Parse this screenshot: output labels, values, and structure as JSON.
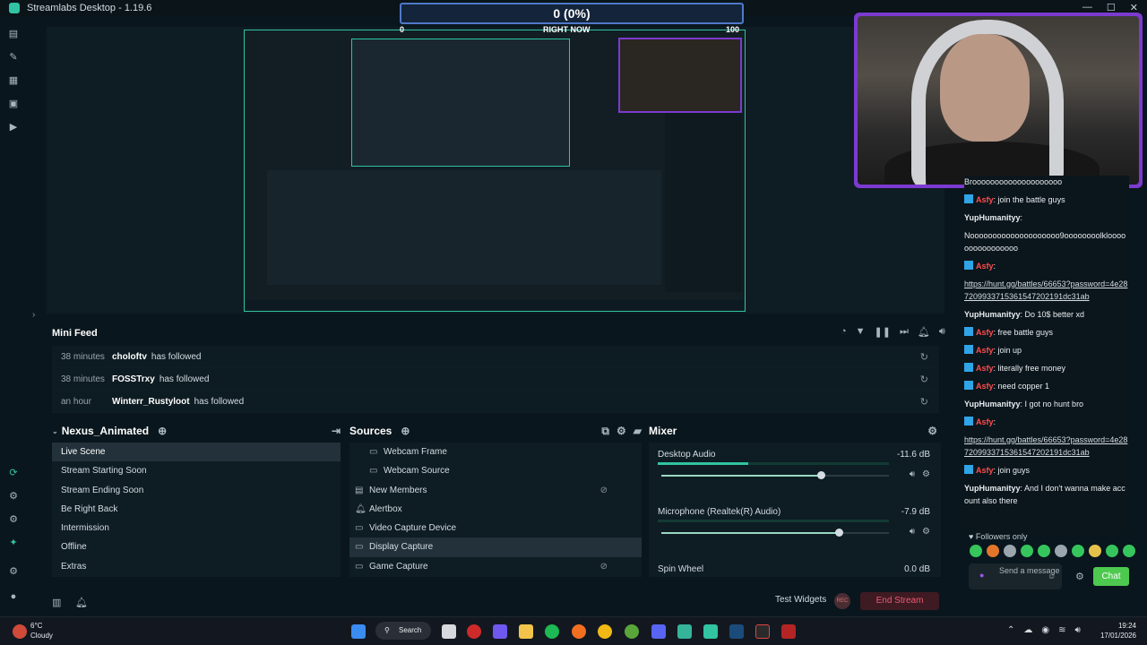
{
  "window": {
    "title": "Streamlabs Desktop - 1.19.6"
  },
  "goal": {
    "value": "0 (0%)",
    "min": "0",
    "max": "100",
    "label": "RIGHT NOW"
  },
  "minifeed": {
    "title": "Mini Feed",
    "items": [
      {
        "time": "38 minutes",
        "user": "choloftv",
        "action": "has followed"
      },
      {
        "time": "38 minutes",
        "user": "FOSSTrxy",
        "action": "has followed"
      },
      {
        "time": "an hour",
        "user": "Winterr_Rustyloot",
        "action": "has followed"
      }
    ]
  },
  "scenes": {
    "title": "Nexus_Animated",
    "items": [
      "Live Scene",
      "Stream Starting Soon",
      "Stream Ending Soon",
      "Be Right Back",
      "Intermission",
      "Offline",
      "Extras"
    ],
    "active": 0
  },
  "sources": {
    "title": "Sources",
    "items": [
      "Webcam Frame",
      "Webcam Source",
      "New Members",
      "Alertbox",
      "Video Capture Device",
      "Display Capture",
      "Game Capture"
    ],
    "active": 5
  },
  "mixer": {
    "title": "Mixer",
    "items": [
      {
        "name": "Desktop Audio",
        "db": "-11.6 dB",
        "level": 0.39,
        "volume": 0.7
      },
      {
        "name": "Microphone (Realtek(R) Audio)",
        "db": "-7.9 dB",
        "level": 0.0,
        "volume": 0.78
      },
      {
        "name": "Spin Wheel",
        "db": "0.0 dB",
        "level": 0.0,
        "volume": 1.0
      }
    ]
  },
  "footer": {
    "test_widgets": "Test Widgets",
    "rec": "REC",
    "end_stream": "End Stream"
  },
  "chat": {
    "messages": [
      {
        "nick": "",
        "text": "Broooooooooooooooooooo",
        "color": "#e8edf0"
      },
      {
        "nick": "Asfy",
        "text": ": join the battle guys",
        "color": "#ff4d4d"
      },
      {
        "nick": "YupHumanityy",
        "text": ":",
        "color": "#e8edf0"
      },
      {
        "nick": "",
        "text": "Noooooooooooooooooooo9oooooooolkloooooooooooooooo",
        "color": "#e8edf0"
      },
      {
        "nick": "Asfy",
        "text": ":",
        "color": "#ff4d4d"
      },
      {
        "nick": "",
        "text": "https://hunt.gg/battles/66653?password=4e287209933715361547202191dc31ab",
        "color": "#e8edf0"
      },
      {
        "nick": "YupHumanityy",
        "text": ": Do 10$ better xd",
        "color": "#e8edf0"
      },
      {
        "nick": "Asfy",
        "text": ": free battle guys",
        "color": "#ff4d4d"
      },
      {
        "nick": "Asfy",
        "text": ": join up",
        "color": "#ff4d4d"
      },
      {
        "nick": "Asfy",
        "text": ": literally free money",
        "color": "#ff4d4d"
      },
      {
        "nick": "Asfy",
        "text": ": need copper 1",
        "color": "#ff4d4d"
      },
      {
        "nick": "YupHumanityy",
        "text": ": I got no hunt bro",
        "color": "#e8edf0"
      },
      {
        "nick": "Asfy",
        "text": ":",
        "color": "#ff4d4d"
      },
      {
        "nick": "",
        "text": "https://hunt.gg/battles/66653?password=4e287209933715361547202191dc31ab",
        "color": "#e8edf0"
      },
      {
        "nick": "Asfy",
        "text": ": join guys",
        "color": "#ff4d4d"
      },
      {
        "nick": "YupHumanityy",
        "text": ": And I don't wanna make account also there",
        "color": "#e8edf0"
      }
    ],
    "followers_only": "Followers only",
    "input_placeholder": "Send a message",
    "chat_button": "Chat"
  },
  "taskbar": {
    "weather_temp": "6°C",
    "weather_desc": "Cloudy",
    "search": "Search",
    "time": "19:24",
    "date": "17/01/2026"
  }
}
